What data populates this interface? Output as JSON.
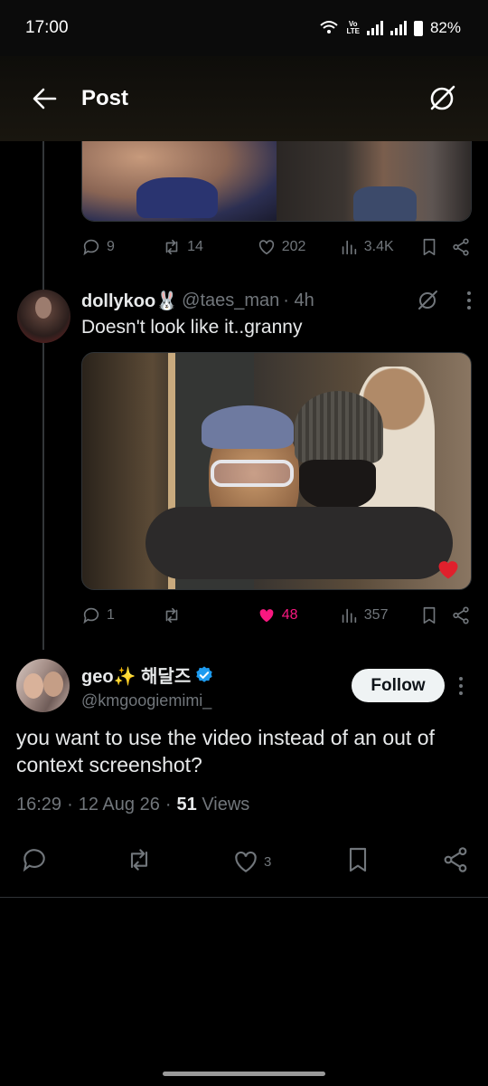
{
  "status": {
    "time": "17:00",
    "battery": "82%",
    "network_top": "Vo",
    "network_bottom": "LTE"
  },
  "header": {
    "title": "Post"
  },
  "prev_tweet": {
    "replies": "9",
    "retweets": "14",
    "likes": "202",
    "views": "3.4K"
  },
  "reply_tweet": {
    "display_name": "dollykoo🐰",
    "handle": "@taes_man",
    "time": "· 4h",
    "text": "Doesn't look like it..granny",
    "replies": "1",
    "retweets": "",
    "likes": "48",
    "views": "357"
  },
  "main_tweet": {
    "display_name": "geo✨ 해달즈",
    "handle": "@kmgoogiemimi_",
    "follow_label": "Follow",
    "text": "you want to use the video instead of an out of context screenshot?",
    "time": "16:29",
    "date": "12 Aug 26",
    "views_count": "51",
    "views_label": "Views",
    "likes": "3"
  },
  "colors": {
    "accent": "#1d9bf0",
    "like_pink": "#f91880",
    "muted": "#71767b"
  }
}
